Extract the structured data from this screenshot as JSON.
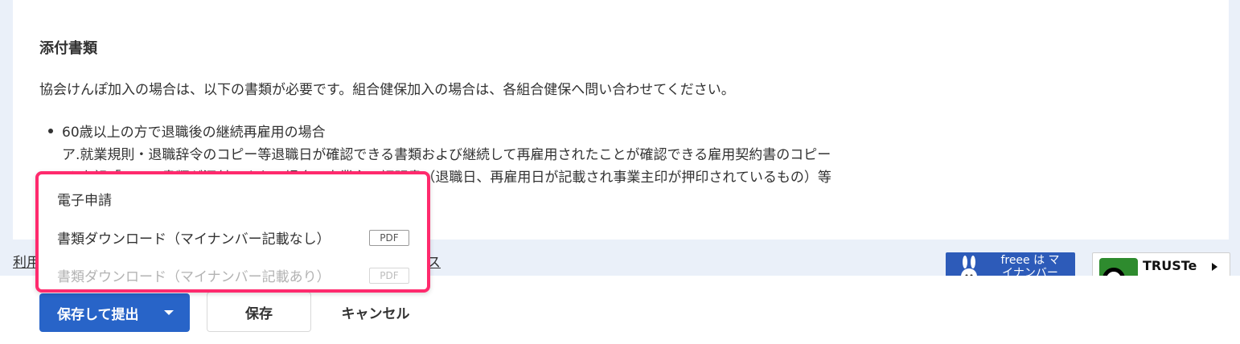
{
  "section": {
    "title": "添付書類",
    "intro": "協会けんぽ加入の場合は、以下の書類が必要です。組合健保加入の場合は、各組合健保へ問い合わせてください。",
    "bullet_line1": "60歳以上の方で退職後の継続再雇用の場合",
    "bullet_line2": "ア.就業規則・退職辞令のコピー等退職日が確認できる書類および継続して再雇用されたことが確認できる雇用契約書のコピー",
    "bullet_line3": "イ.上記「ア」の書類が添付できない場合、事業主の証明書（退職日、再雇用日が記載され事業主印が押印されているもの）等"
  },
  "footer": {
    "link_left": "利用",
    "link_right": "ストア",
    "freee_badge_text": "freee は マイナンバー",
    "truste_badge_text": "TRUSTe"
  },
  "dropdown": {
    "items": [
      {
        "label": "電子申請",
        "badge": ""
      },
      {
        "label": "書類ダウンロード（マイナンバー記載なし）",
        "badge": "PDF"
      },
      {
        "label": "書類ダウンロード（マイナンバー記載あり）",
        "badge": "PDF"
      }
    ]
  },
  "actions": {
    "submit_label": "保存して提出",
    "save_label": "保存",
    "cancel_label": "キャンセル"
  },
  "colors": {
    "primary": "#2864c8",
    "dropdown_highlight": "#ff2a6d",
    "page_bg": "#eaf0f9"
  },
  "icons": {
    "submit_dropdown": "chevron-down-icon",
    "freee_mascot": "rabbit-mascot-icon",
    "truste_logo": "truste-seal-icon"
  }
}
